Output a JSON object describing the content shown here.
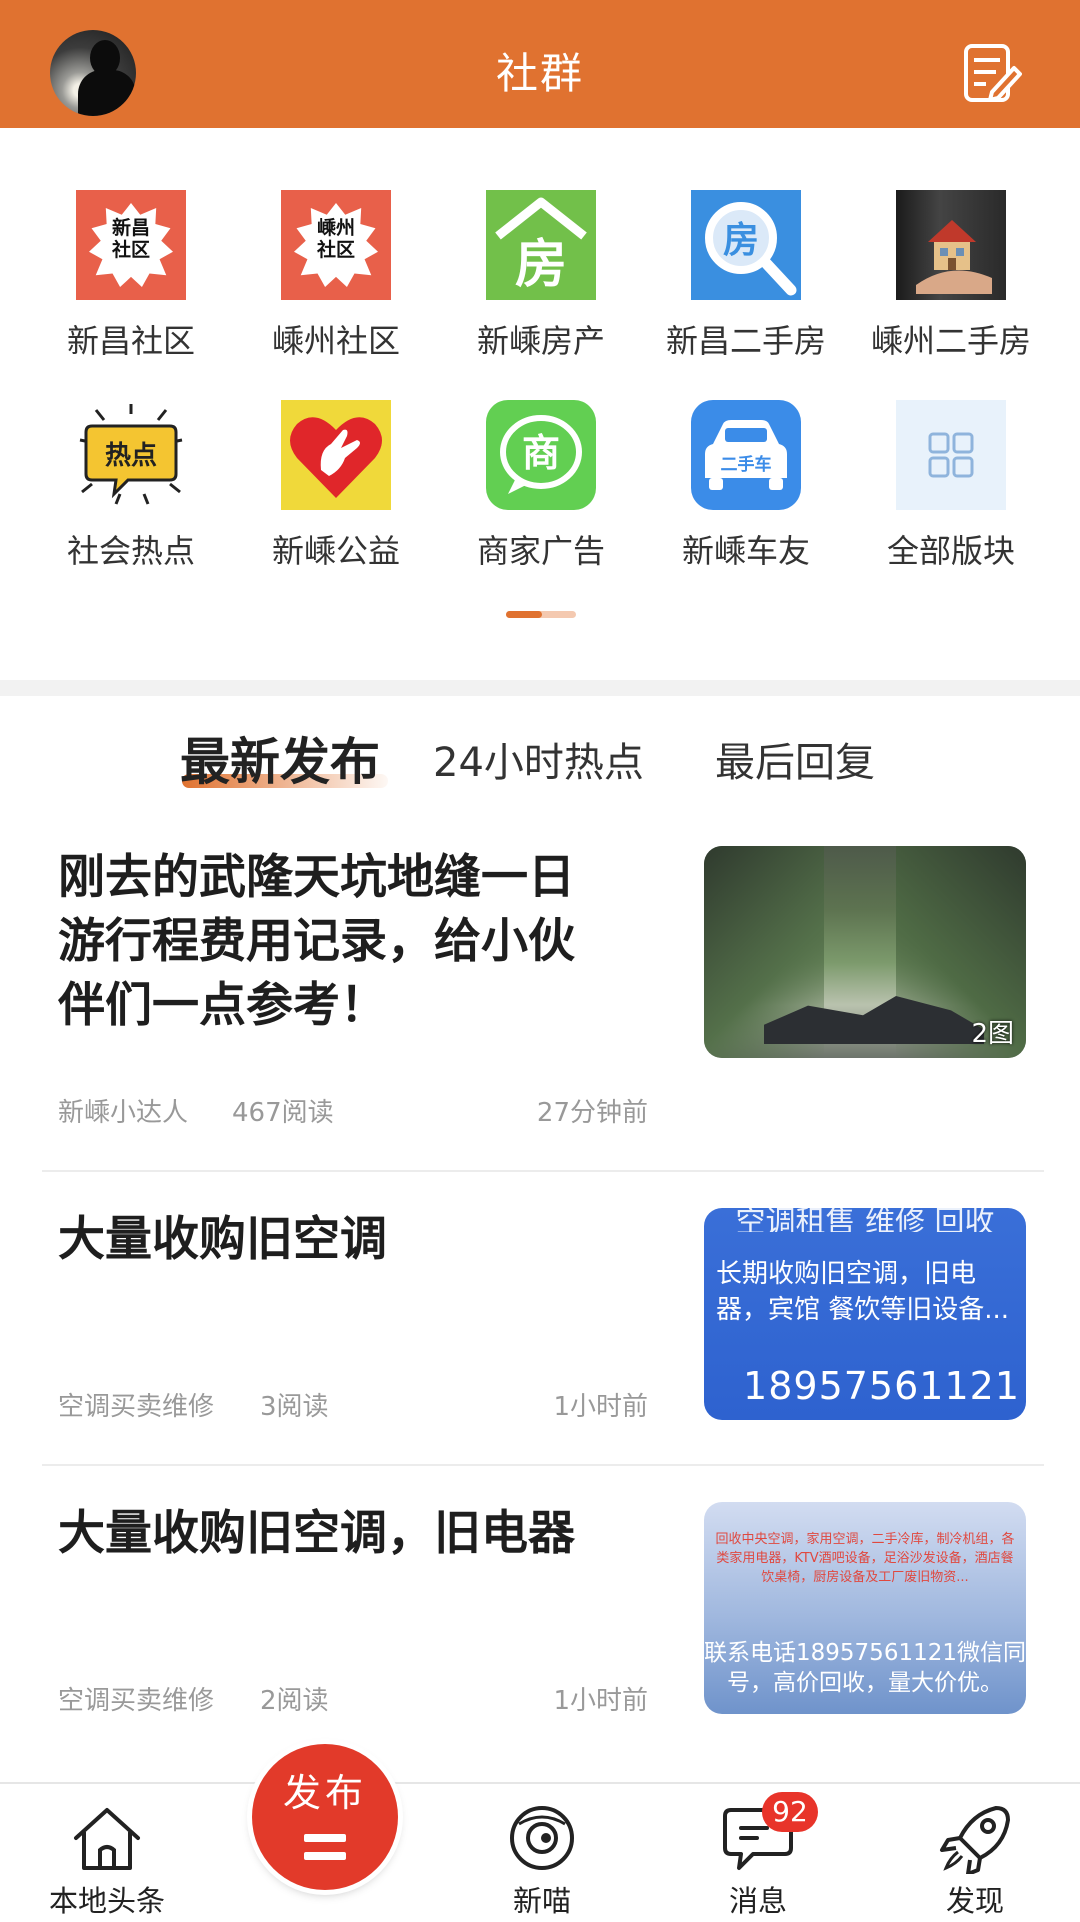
{
  "header": {
    "title": "社群"
  },
  "boards": [
    {
      "label": "新昌社区",
      "icon": "xinchang-community-icon",
      "tile_text_1": "新昌",
      "tile_text_2": "社区"
    },
    {
      "label": "嵊州社区",
      "icon": "shengzhou-community-icon",
      "tile_text_1": "嵊州",
      "tile_text_2": "社区"
    },
    {
      "label": "新嵊房产",
      "icon": "real-estate-icon",
      "tile_text": "房"
    },
    {
      "label": "新昌二手房",
      "icon": "house-search-icon",
      "tile_text": "房"
    },
    {
      "label": "嵊州二手房",
      "icon": "house-in-hand-icon"
    },
    {
      "label": "社会热点",
      "icon": "hot-topics-icon",
      "tile_text": "热点"
    },
    {
      "label": "新嵊公益",
      "icon": "charity-heart-icon"
    },
    {
      "label": "商家广告",
      "icon": "merchant-ad-icon",
      "tile_text": "商"
    },
    {
      "label": "新嵊车友",
      "icon": "car-icon",
      "tile_text": "二手车"
    },
    {
      "label": "全部版块",
      "icon": "grid-icon"
    }
  ],
  "pager": {
    "pages": 2,
    "current": 1
  },
  "tabs": [
    {
      "label": "最新发布",
      "active": true
    },
    {
      "label": "24小时热点",
      "active": false
    },
    {
      "label": "最后回复",
      "active": false
    }
  ],
  "feed": [
    {
      "title": "刚去的武隆天坑地缝一日游行程费用记录，给小伙伴们一点参考！",
      "author": "新嵊小达人",
      "reads": "467阅读",
      "time": "27分钟前",
      "thumb_badge": "2图"
    },
    {
      "title": "大量收购旧空调",
      "author": "空调买卖维修",
      "reads": "3阅读",
      "time": "1小时前",
      "thumb_top": "空调租售 维修 回收",
      "thumb_body": "长期收购旧空调，旧电器，宾馆 餐饮等旧设备...",
      "thumb_phone": "18957561121"
    },
    {
      "title": "大量收购旧空调，旧电器",
      "author": "空调买卖维修",
      "reads": "2阅读",
      "time": "1小时前",
      "thumb_small": "回收中央空调，家用空调，二手冷库，制冷机组，各类家用电器，KTV酒吧设备，足浴沙发设备，酒店餐饮桌椅，厨房设备及工厂废旧物资...",
      "thumb_big": "联系电话18957561121微信同号，高价回收，量大价优。"
    }
  ],
  "bottom_nav": {
    "home": "本地头条",
    "publish": "发布",
    "xinmiao": "新喵",
    "messages": "消息",
    "messages_badge": "92",
    "discover": "发现"
  },
  "colors": {
    "brand": "#e07230",
    "badge": "#e8342a",
    "publish": "#e23a2a"
  }
}
